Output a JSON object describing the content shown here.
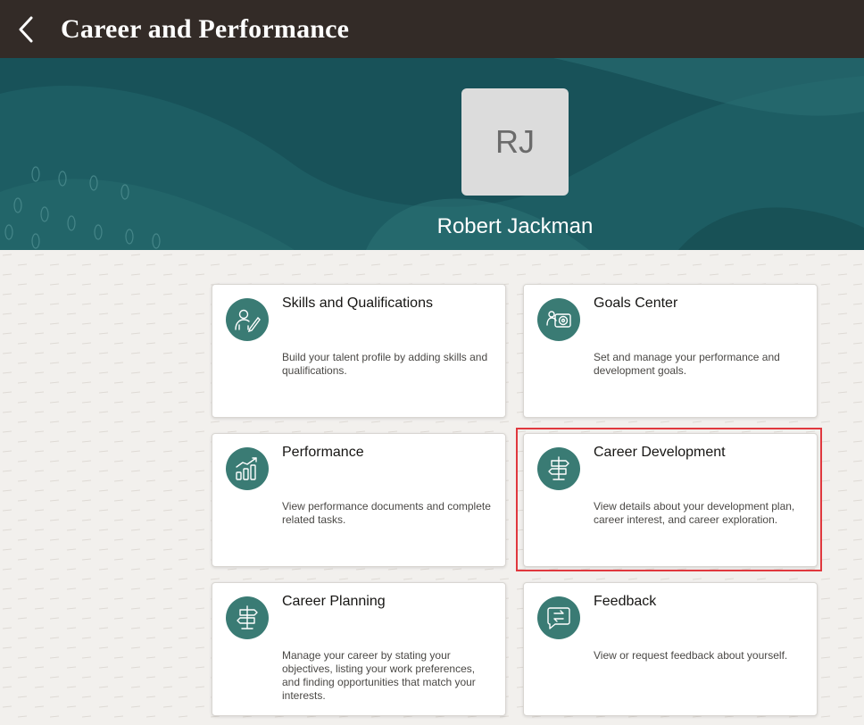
{
  "header": {
    "title": "Career and Performance",
    "back_icon": "chevron-left-icon"
  },
  "profile": {
    "initials": "RJ",
    "name": "Robert Jackman"
  },
  "colors": {
    "header_bg": "#332b27",
    "banner_bg": "#1d5d63",
    "icon_bg": "#3a7b74",
    "highlight": "#e0383e"
  },
  "cards": [
    {
      "title": "Skills and Qualifications",
      "description": "Build your talent profile by adding skills and qualifications.",
      "icon": "person-edit-icon"
    },
    {
      "title": "Goals Center",
      "description": "Set and manage your performance and development goals.",
      "icon": "goals-target-icon"
    },
    {
      "title": "Performance",
      "description": "View performance documents and complete related tasks.",
      "icon": "bar-chart-growth-icon"
    },
    {
      "title": "Career Development",
      "description": "View details about your development plan, career interest, and career exploration.",
      "icon": "signpost-icon"
    },
    {
      "title": "Career Planning",
      "description": "Manage your career by stating your objectives, listing your work preferences, and finding opportunities that match your interests.",
      "icon": "signpost-icon"
    },
    {
      "title": "Feedback",
      "description": "View or request feedback about yourself.",
      "icon": "feedback-chat-icon"
    }
  ]
}
